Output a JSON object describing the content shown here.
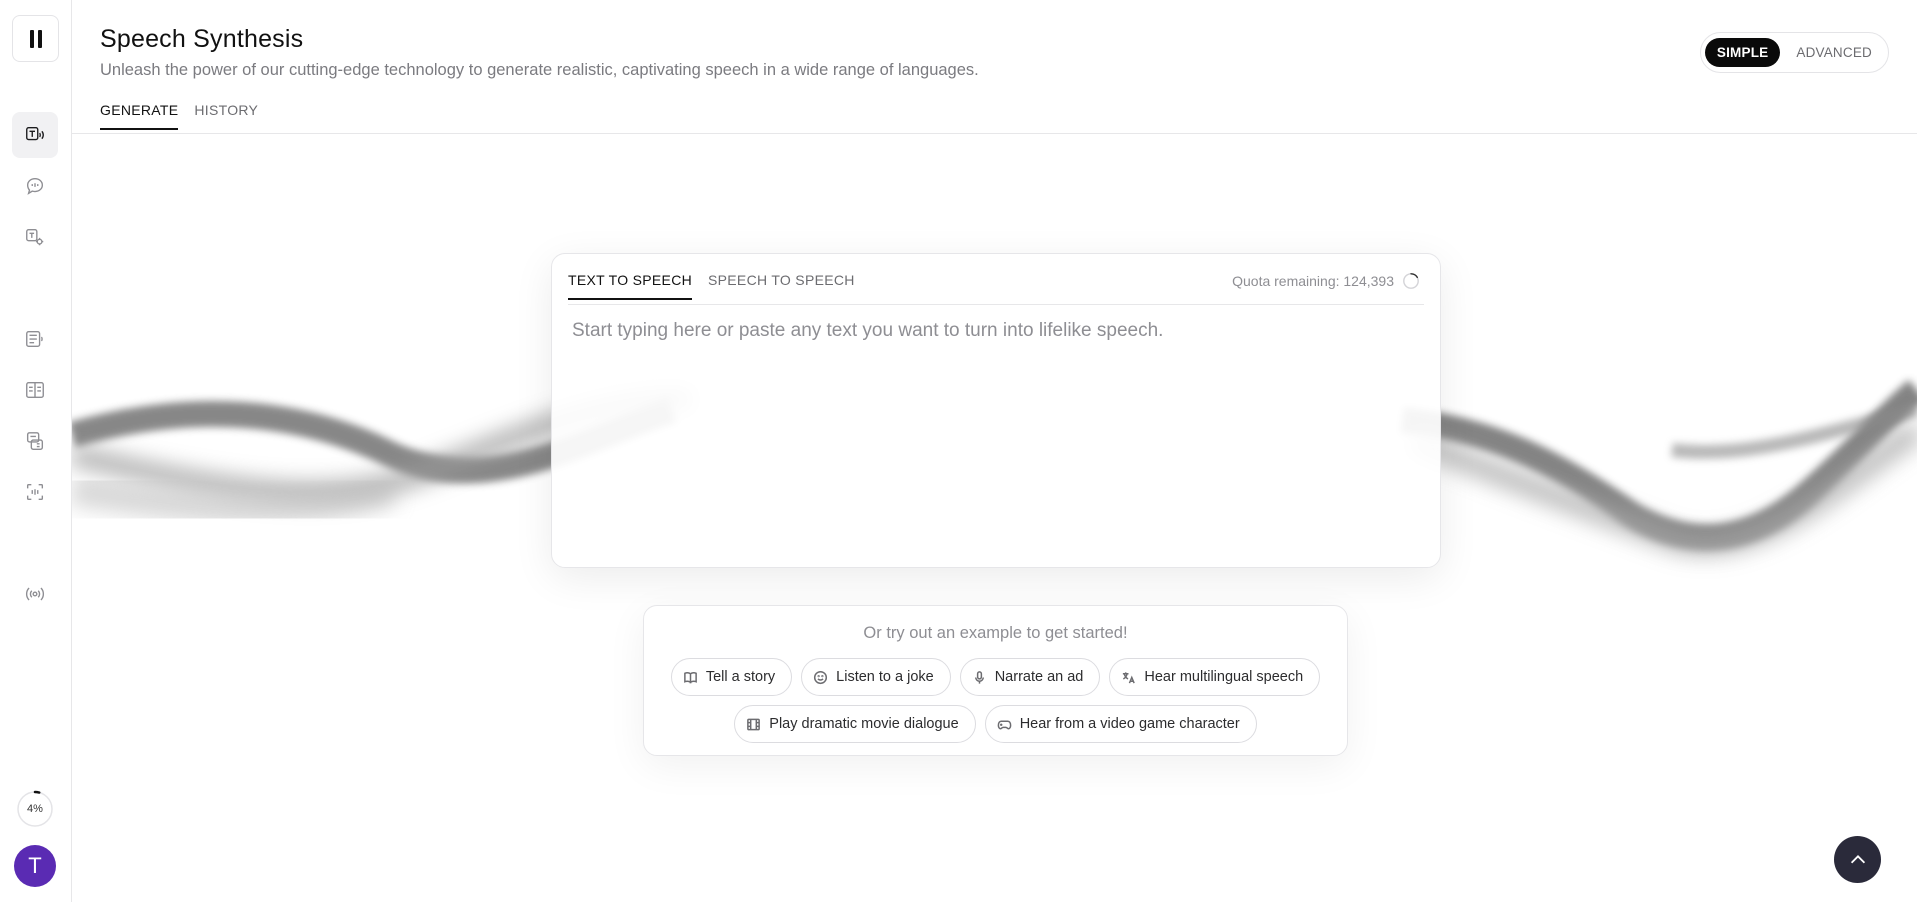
{
  "header": {
    "title": "Speech Synthesis",
    "subtitle": "Unleash the power of our cutting-edge technology to generate realistic, captivating speech in a wide range of languages.",
    "tabs": [
      {
        "label": "GENERATE",
        "active": true
      },
      {
        "label": "HISTORY",
        "active": false
      }
    ],
    "mode_toggle": {
      "simple": "SIMPLE",
      "advanced": "ADVANCED",
      "selected": "SIMPLE"
    }
  },
  "sidebar": {
    "items": [
      {
        "icon": "text-to-speech-icon",
        "active": true
      },
      {
        "icon": "voice-chat-icon",
        "active": false
      },
      {
        "icon": "voice-settings-icon",
        "active": false
      },
      {
        "icon": "projects-icon",
        "active": false
      },
      {
        "icon": "layout-icon",
        "active": false
      },
      {
        "icon": "dubbing-icon",
        "active": false
      },
      {
        "icon": "voice-isolator-icon",
        "active": false
      },
      {
        "icon": "audio-icon",
        "active": false
      }
    ],
    "usage_percent": "4%",
    "usage_fraction": 0.04,
    "avatar_initial": "T",
    "avatar_color": "#5a2bb3"
  },
  "card": {
    "tabs": [
      {
        "label": "TEXT TO SPEECH",
        "active": true
      },
      {
        "label": "SPEECH TO SPEECH",
        "active": false
      }
    ],
    "quota_text": "Quota remaining: 124,393",
    "input_placeholder": "Start typing here or paste any text you want to turn into lifelike speech.",
    "input_value": ""
  },
  "examples": {
    "title": "Or try out an example to get started!",
    "row1": [
      {
        "label": "Tell a story",
        "icon": "book-icon"
      },
      {
        "label": "Listen to a joke",
        "icon": "smile-icon"
      },
      {
        "label": "Narrate an ad",
        "icon": "microphone-icon"
      },
      {
        "label": "Hear multilingual speech",
        "icon": "translate-icon"
      }
    ],
    "row2": [
      {
        "label": "Play dramatic movie dialogue",
        "icon": "film-icon"
      },
      {
        "label": "Hear from a video game character",
        "icon": "gamepad-icon"
      }
    ]
  },
  "colors": {
    "accent": "#0a0a0a",
    "scroll_top_button": "#2a2a3a"
  }
}
